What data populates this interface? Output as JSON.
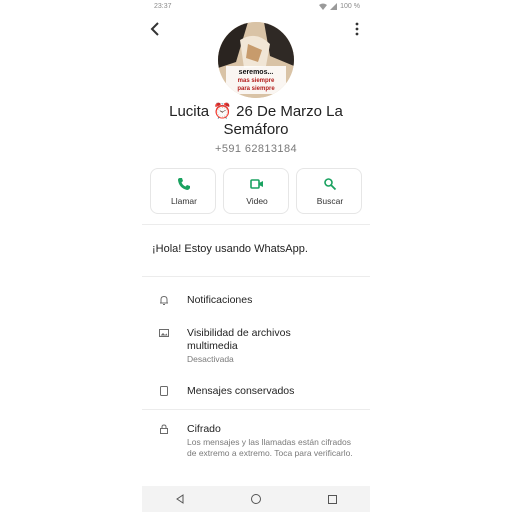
{
  "status_bar": {
    "time": "23:37",
    "battery": "100 %"
  },
  "header": {
    "back_icon": "arrow-back-icon",
    "more_icon": "more-vert-icon"
  },
  "contact": {
    "name": "Lucita ⏰ 26 De Marzo La Semáforo",
    "phone": "+591 62813184",
    "avatar_caption_line1": "seremos...",
    "avatar_caption_line2": "mas siempre",
    "avatar_caption_line3": "para siempre"
  },
  "actions": [
    {
      "label": "Llamar",
      "icon": "phone-icon"
    },
    {
      "label": "Video",
      "icon": "video-icon"
    },
    {
      "label": "Buscar",
      "icon": "search-icon"
    }
  ],
  "about": "¡Hola! Estoy usando WhatsApp.",
  "settings": [
    {
      "title": "Notificaciones",
      "subtitle": "",
      "icon": "bell-icon"
    },
    {
      "title": "Visibilidad de archivos multimedia",
      "subtitle": "Desactivada",
      "icon": "image-icon"
    },
    {
      "title": "Mensajes conservados",
      "subtitle": "",
      "icon": "bookmark-icon"
    },
    {
      "title": "Cifrado",
      "subtitle": "Los mensajes y las llamadas están cifrados de extremo a extremo. Toca para verificarlo.",
      "icon": "lock-icon"
    }
  ],
  "navbar": [
    "back-nav-icon",
    "home-nav-icon",
    "recents-nav-icon"
  ],
  "colors": {
    "accent": "#1aa260",
    "divider": "#ececec",
    "icon_gray": "#6b6b6b"
  }
}
